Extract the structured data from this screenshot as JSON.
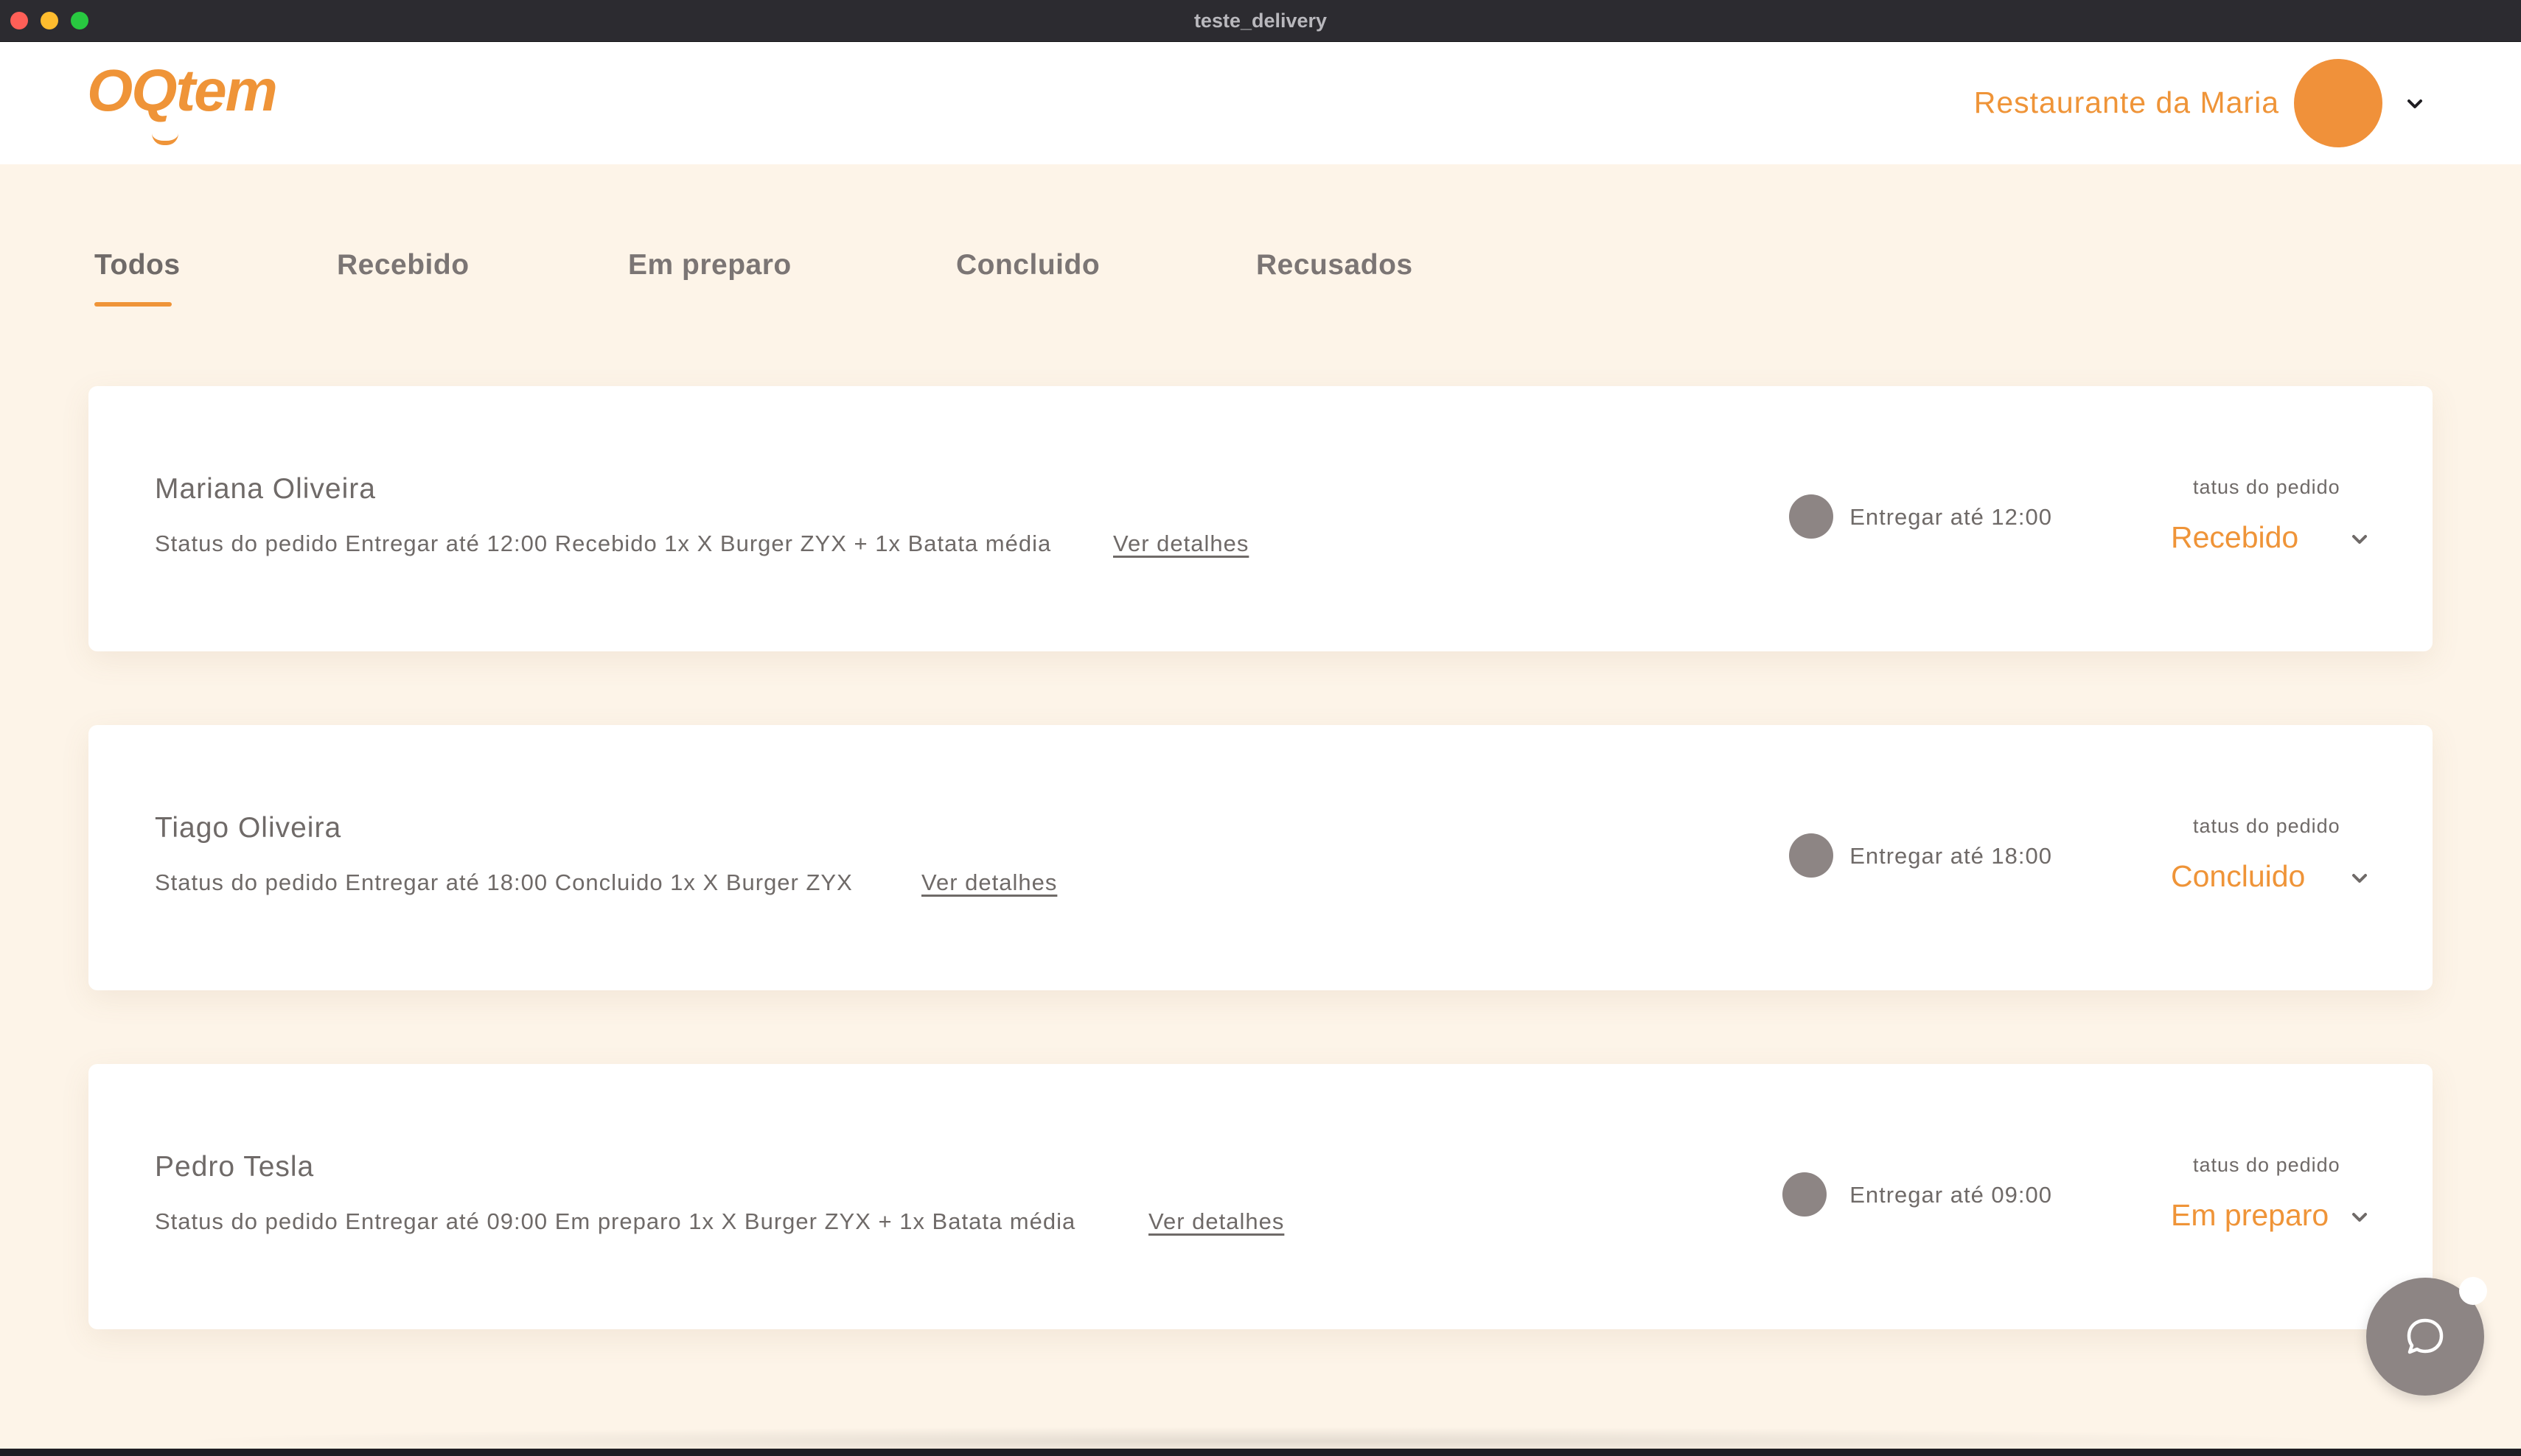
{
  "window": {
    "title": "teste_delivery"
  },
  "header": {
    "logo_text": "OQtem",
    "restaurant_name": "Restaurante da Maria",
    "profile_menu_icon": "chevron-down-icon"
  },
  "tabs": [
    {
      "label": "Todos",
      "active": true
    },
    {
      "label": "Recebido",
      "active": false
    },
    {
      "label": "Em preparo",
      "active": false
    },
    {
      "label": "Concluido",
      "active": false
    },
    {
      "label": "Recusados",
      "active": false
    }
  ],
  "orders": [
    {
      "customer": "Mariana Oliveira",
      "summary": "Status do pedido Entregar até 12:00 Recebido 1x X Burger ZYX + 1x Batata média",
      "details_link": "Ver detalhes",
      "delivery_time": "Entregar até 12:00",
      "status_label": "tatus do pedido",
      "status_value": "Recebido"
    },
    {
      "customer": "Tiago Oliveira",
      "summary": "Status do pedido Entregar até 18:00 Concluido 1x X Burger ZYX",
      "details_link": "Ver detalhes",
      "delivery_time": "Entregar até 18:00",
      "status_label": "tatus do pedido",
      "status_value": "Concluido"
    },
    {
      "customer": "Pedro Tesla",
      "summary": "Status do pedido Entregar até 09:00 Em preparo 1x X Burger ZYX + 1x Batata média",
      "details_link": "Ver detalhes",
      "delivery_time": "Entregar até 09:00",
      "status_label": "tatus do pedido",
      "status_value": "Em preparo"
    }
  ],
  "chat": {
    "icon": "chat-bubble-icon"
  },
  "colors": {
    "accent": "#ef9438",
    "background": "#fdf4e8",
    "text": "#6f6a68",
    "muted_dot": "#8d8584"
  }
}
